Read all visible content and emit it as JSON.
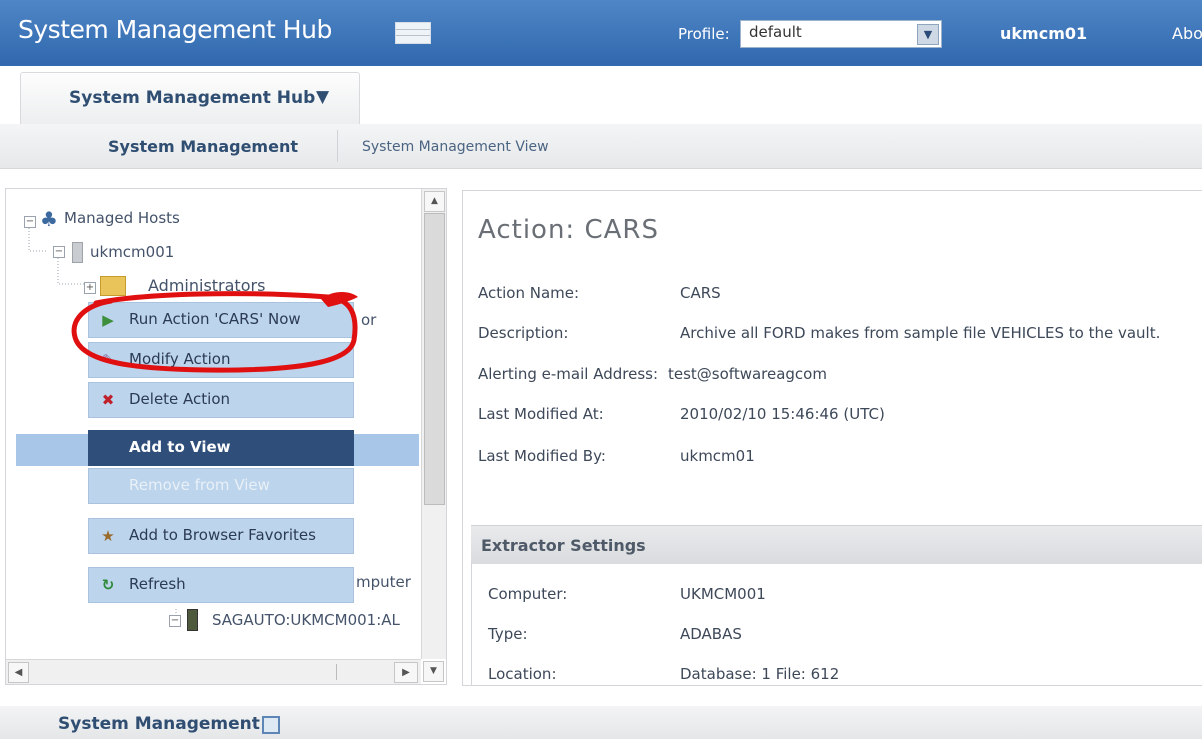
{
  "header": {
    "app_title": "System Management Hub",
    "profile_label": "Profile:",
    "profile_value": "default",
    "user": "ukmcm01",
    "about": "Abo"
  },
  "hub_tab": {
    "label": "System Management Hub"
  },
  "subnav": {
    "items": [
      "System Management",
      "System Management View"
    ]
  },
  "tree": {
    "root": "Managed Hosts",
    "host": "ukmcm001",
    "administrators": "Administrators",
    "partial_text": "or",
    "computer_partial": "mputer",
    "node": "SAGAUTO:UKMCM001:AL"
  },
  "context_menu": {
    "items": [
      "Run Action 'CARS' Now",
      "Modify Action",
      "Delete Action",
      "Add to View",
      "Remove from View",
      "Add to Browser Favorites",
      "Refresh"
    ]
  },
  "details": {
    "title": "Action: CARS",
    "fields": [
      {
        "label": "Action Name:",
        "value": "CARS"
      },
      {
        "label": "Description:",
        "value": "Archive all FORD makes from sample file VEHICLES to the vault."
      },
      {
        "label": "Alerting e-mail Address:",
        "value": "test@softwareagcom"
      },
      {
        "label": "Last Modified At:",
        "value": "2010/02/10 15:46:46 (UTC)"
      },
      {
        "label": "Last Modified By:",
        "value": "ukmcm01"
      }
    ],
    "extractor_title": "Extractor Settings",
    "extractor_fields": [
      {
        "label": "Computer:",
        "value": "UKMCM001"
      },
      {
        "label": "Type:",
        "value": "ADABAS"
      },
      {
        "label": "Location:",
        "value": "Database: 1 File: 612"
      }
    ]
  },
  "bottom": {
    "label": "System Management"
  },
  "colors": {
    "banner": "#3c74b8",
    "menu_selected": "#2f4e7a",
    "annotation": "#e01010"
  }
}
